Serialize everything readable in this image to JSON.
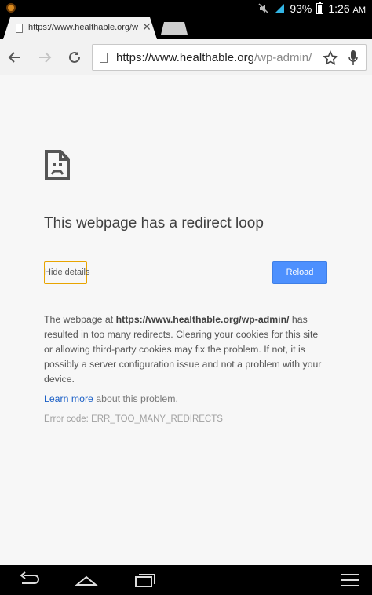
{
  "status_bar": {
    "battery_percent": "93%",
    "time": "1:26",
    "time_suffix": "AM",
    "icons": [
      "notification-icon",
      "mute-icon",
      "signal-icon",
      "battery-icon"
    ]
  },
  "tab": {
    "title": "https://www.healthable.org/wp-admin/",
    "close_glyph": "✕"
  },
  "toolbar": {
    "url_host": "https://www.healthable.org",
    "url_path": "/wp-admin/",
    "icons": [
      "back-icon",
      "forward-icon",
      "reload-icon",
      "page-icon",
      "star-icon",
      "mic-icon"
    ]
  },
  "error": {
    "heading": "This webpage has a redirect loop",
    "hide_details_label": "Hide details",
    "reload_label": "Reload",
    "desc_prefix": "The webpage at ",
    "desc_url": "https://www.healthable.org/wp-admin/",
    "desc_suffix": " has resulted in too many redirects. Clearing your cookies for this site or allowing third-party cookies may fix the problem. If not, it is possibly a server configuration issue and not a problem with your device.",
    "learn_more_link": "Learn more",
    "learn_more_suffix": " about this problem.",
    "error_code": "Error code: ERR_TOO_MANY_REDIRECTS"
  },
  "navbar": {
    "icons": [
      "nav-back-icon",
      "nav-home-icon",
      "nav-recent-apps-icon",
      "nav-menu-icon"
    ]
  },
  "colors": {
    "reload_button": "#4d90fe",
    "focus_outline": "#e8a400",
    "link": "#1a5fc6",
    "status_bar_signal": "#33b5e5"
  }
}
